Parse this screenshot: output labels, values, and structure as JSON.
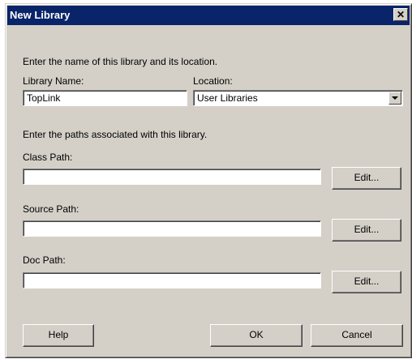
{
  "window": {
    "title": "New Library",
    "close_glyph": "✕"
  },
  "intro_text": "Enter the name of this library and its location.",
  "library_name": {
    "label": "Library Name:",
    "value": "TopLink"
  },
  "location": {
    "label": "Location:",
    "value": "User Libraries"
  },
  "paths_intro": "Enter the paths associated with this library.",
  "class_path": {
    "label": "Class Path:",
    "value": "",
    "edit_label": "Edit..."
  },
  "source_path": {
    "label": "Source Path:",
    "value": "",
    "edit_label": "Edit..."
  },
  "doc_path": {
    "label": "Doc Path:",
    "value": "",
    "edit_label": "Edit..."
  },
  "buttons": {
    "help": "Help",
    "ok": "OK",
    "cancel": "Cancel"
  },
  "colors": {
    "dialog_bg": "#d4d0c8",
    "titlebar_bg": "#0a246a"
  },
  "icons": {
    "close": "close-icon",
    "dropdown": "chevron-down-icon"
  }
}
